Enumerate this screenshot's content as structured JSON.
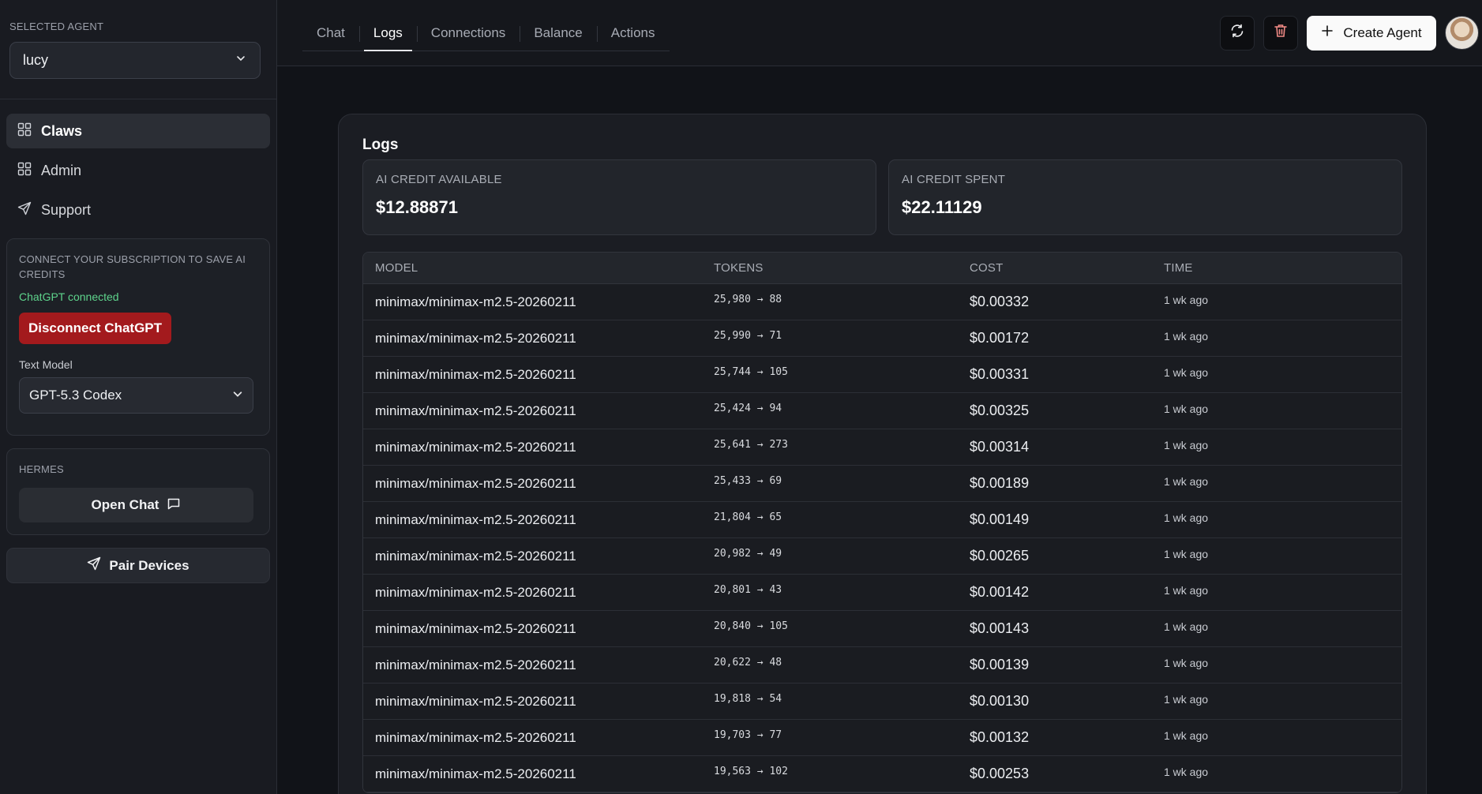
{
  "sidebar": {
    "selected_agent_label": "SELECTED AGENT",
    "agent_value": "lucy",
    "nav": [
      {
        "label": "Claws",
        "icon": "grid-icon",
        "active": true
      },
      {
        "label": "Admin",
        "icon": "grid-icon",
        "active": false
      },
      {
        "label": "Support",
        "icon": "send-icon",
        "active": false
      }
    ],
    "subscription": {
      "title": "CONNECT YOUR SUBSCRIPTION TO SAVE AI CREDITS",
      "status": "ChatGPT connected",
      "disconnect_label": "Disconnect ChatGPT",
      "text_model_label": "Text Model",
      "text_model_value": "GPT-5.3 Codex"
    },
    "hermes": {
      "title": "HERMES",
      "open_chat_label": "Open Chat"
    },
    "pair_devices_label": "Pair Devices"
  },
  "header": {
    "tabs": [
      {
        "label": "Chat",
        "active": false
      },
      {
        "label": "Logs",
        "active": true
      },
      {
        "label": "Connections",
        "active": false
      },
      {
        "label": "Balance",
        "active": false
      },
      {
        "label": "Actions",
        "active": false
      }
    ],
    "create_agent_label": "Create Agent"
  },
  "logs": {
    "title": "Logs",
    "credit_available_label": "AI CREDIT AVAILABLE",
    "credit_available_value": "$12.88871",
    "credit_spent_label": "AI CREDIT SPENT",
    "credit_spent_value": "$22.11129",
    "columns": [
      "MODEL",
      "TOKENS",
      "COST",
      "TIME"
    ],
    "rows": [
      {
        "model": "minimax/minimax-m2.5-20260211",
        "tokens": "25,980 → 88",
        "cost": "$0.00332",
        "time": "1 wk ago"
      },
      {
        "model": "minimax/minimax-m2.5-20260211",
        "tokens": "25,990 → 71",
        "cost": "$0.00172",
        "time": "1 wk ago"
      },
      {
        "model": "minimax/minimax-m2.5-20260211",
        "tokens": "25,744 → 105",
        "cost": "$0.00331",
        "time": "1 wk ago"
      },
      {
        "model": "minimax/minimax-m2.5-20260211",
        "tokens": "25,424 → 94",
        "cost": "$0.00325",
        "time": "1 wk ago"
      },
      {
        "model": "minimax/minimax-m2.5-20260211",
        "tokens": "25,641 → 273",
        "cost": "$0.00314",
        "time": "1 wk ago"
      },
      {
        "model": "minimax/minimax-m2.5-20260211",
        "tokens": "25,433 → 69",
        "cost": "$0.00189",
        "time": "1 wk ago"
      },
      {
        "model": "minimax/minimax-m2.5-20260211",
        "tokens": "21,804 → 65",
        "cost": "$0.00149",
        "time": "1 wk ago"
      },
      {
        "model": "minimax/minimax-m2.5-20260211",
        "tokens": "20,982 → 49",
        "cost": "$0.00265",
        "time": "1 wk ago"
      },
      {
        "model": "minimax/minimax-m2.5-20260211",
        "tokens": "20,801 → 43",
        "cost": "$0.00142",
        "time": "1 wk ago"
      },
      {
        "model": "minimax/minimax-m2.5-20260211",
        "tokens": "20,840 → 105",
        "cost": "$0.00143",
        "time": "1 wk ago"
      },
      {
        "model": "minimax/minimax-m2.5-20260211",
        "tokens": "20,622 → 48",
        "cost": "$0.00139",
        "time": "1 wk ago"
      },
      {
        "model": "minimax/minimax-m2.5-20260211",
        "tokens": "19,818 → 54",
        "cost": "$0.00130",
        "time": "1 wk ago"
      },
      {
        "model": "minimax/minimax-m2.5-20260211",
        "tokens": "19,703 → 77",
        "cost": "$0.00132",
        "time": "1 wk ago"
      },
      {
        "model": "minimax/minimax-m2.5-20260211",
        "tokens": "19,563 → 102",
        "cost": "$0.00253",
        "time": "1 wk ago"
      }
    ]
  }
}
